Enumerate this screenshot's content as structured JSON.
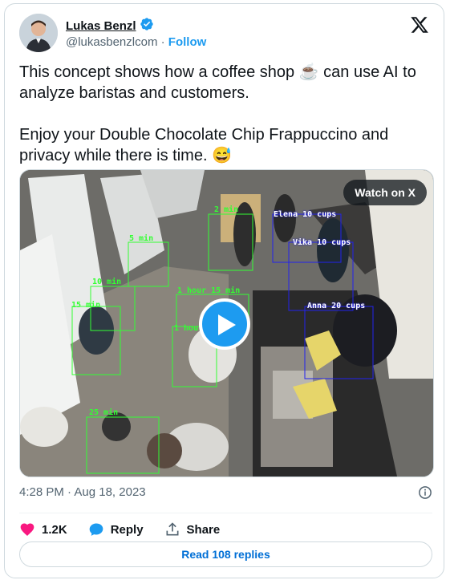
{
  "author": {
    "name": "Lukas Benzl",
    "handle": "@lukasbenzlcom",
    "separator": "·",
    "follow_label": "Follow"
  },
  "tweet": {
    "text": "This concept shows how a coffee shop ☕ can use AI to analyze baristas and customers.\n\nEnjoy your Double Chocolate Chip Frappuccino and privacy while there is time. 😅"
  },
  "media": {
    "watch_label": "Watch on X",
    "detections": [
      {
        "label": "2 min",
        "color": "green"
      },
      {
        "label": "5 min",
        "color": "green"
      },
      {
        "label": "10 min",
        "color": "green"
      },
      {
        "label": "15 min",
        "color": "green"
      },
      {
        "label": "1 hour 15 min",
        "color": "green"
      },
      {
        "label": "1 hour",
        "color": "green"
      },
      {
        "label": "25 min",
        "color": "green"
      },
      {
        "label": "Elena 10 cups",
        "color": "blue"
      },
      {
        "label": "Vika 10 cups",
        "color": "blue"
      },
      {
        "label": "Anna 20 cups",
        "color": "blue"
      }
    ]
  },
  "meta": {
    "time": "4:28 PM",
    "separator": "·",
    "date": "Aug 18, 2023"
  },
  "actions": {
    "likes": "1.2K",
    "reply_label": "Reply",
    "share_label": "Share",
    "read_replies_label": "Read 108 replies"
  }
}
